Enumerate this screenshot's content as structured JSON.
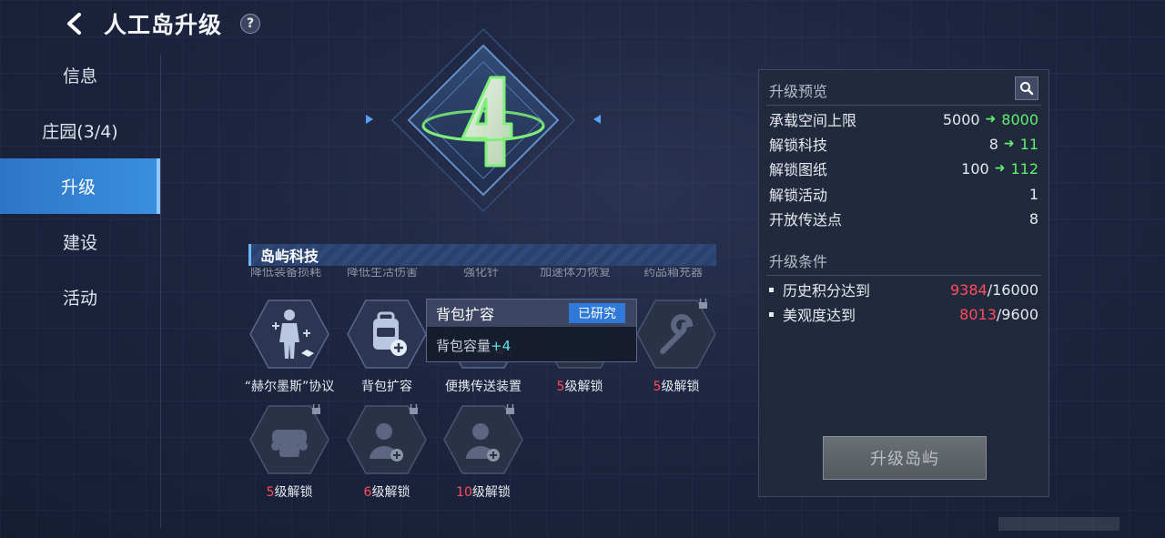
{
  "header": {
    "title": "人工岛升级",
    "help_label": "?"
  },
  "sidebar": {
    "items": [
      {
        "label": "信息"
      },
      {
        "label": "庄园(3/4)"
      },
      {
        "label": "升级",
        "active": true
      },
      {
        "label": "建设"
      },
      {
        "label": "活动"
      }
    ]
  },
  "emblem": {
    "level": "4",
    "accent_color": "#7ef07a"
  },
  "tech": {
    "section_title": "岛屿科技",
    "faded_labels": [
      "降低装备损耗",
      "降低生活伤害",
      "强化针",
      "加速体力恢复",
      "药品箱充器"
    ],
    "items": [
      {
        "label": "“赫尔墨斯”协议",
        "icon": "human-figure-icon",
        "unlocked": true
      },
      {
        "label": "背包扩容",
        "icon": "backpack-plus-icon",
        "unlocked": true
      },
      {
        "label": "便携传送装置",
        "icon": "teleport-device-icon",
        "unlocked": true
      },
      {
        "level": "5",
        "suffix": "级解锁",
        "icon": "gear-locked-icon",
        "unlocked": false
      },
      {
        "level": "5",
        "suffix": "级解锁",
        "icon": "wrench-locked-icon",
        "unlocked": false
      },
      {
        "level": "5",
        "suffix": "级解锁",
        "icon": "vehicle-locked-icon",
        "unlocked": false
      },
      {
        "level": "6",
        "suffix": "级解锁",
        "icon": "person-plus-locked-icon",
        "unlocked": false
      },
      {
        "level": "10",
        "suffix": "级解锁",
        "icon": "person-plus-locked-icon",
        "unlocked": false
      }
    ]
  },
  "tooltip": {
    "title": "背包扩容",
    "badge": "已研究",
    "desc_prefix": "背包容量",
    "desc_value": "+4"
  },
  "panel": {
    "preview_title": "升级预览",
    "stats": [
      {
        "label": "承载空间上限",
        "old": "5000",
        "new": "8000"
      },
      {
        "label": "解锁科技",
        "old": "8",
        "new": "11"
      },
      {
        "label": "解锁图纸",
        "old": "100",
        "new": "112"
      },
      {
        "label": "解锁活动",
        "value": "1"
      },
      {
        "label": "开放传送点",
        "value": "8"
      }
    ],
    "conditions_title": "升级条件",
    "conditions": [
      {
        "label": "历史积分达到",
        "current": "9384",
        "required": "/16000"
      },
      {
        "label": "美观度达到",
        "current": "8013",
        "required": "/9600"
      }
    ],
    "upgrade_button": "升级岛屿"
  },
  "colors": {
    "accent_blue": "#3a8ee0",
    "increase_green": "#5ef06e",
    "insufficient_red": "#ff4d5a",
    "disabled_button": "#5f636a"
  }
}
